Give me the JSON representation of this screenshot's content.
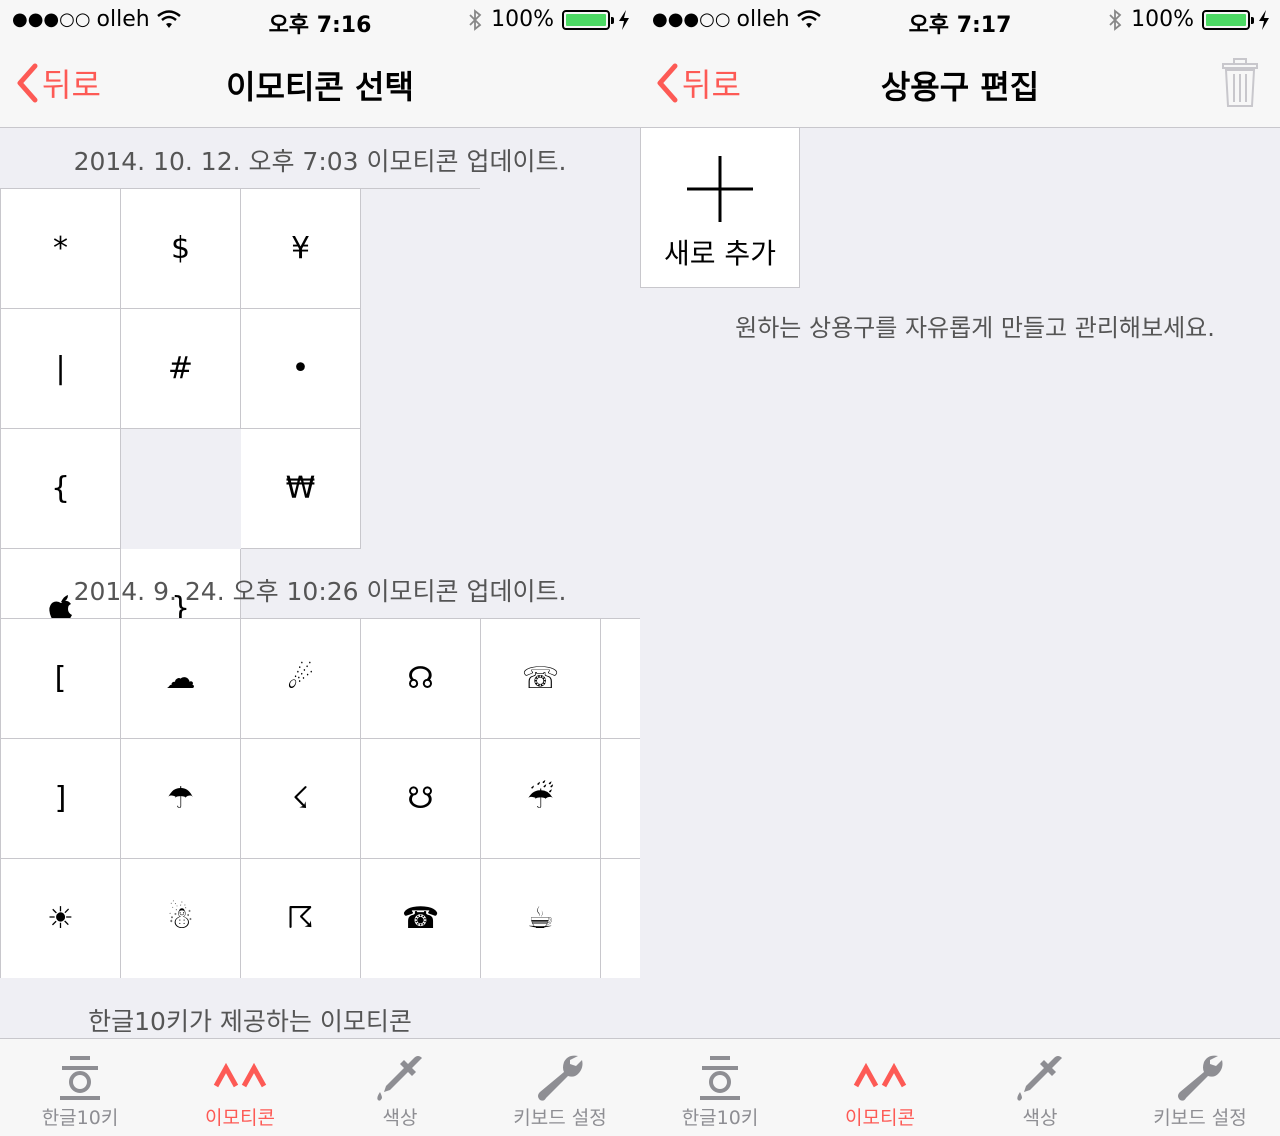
{
  "status_left": {
    "dots": "●●●○○",
    "carrier": "olleh",
    "battery": "100%"
  },
  "status_right": {
    "dots": "●●●○○",
    "carrier": "olleh",
    "battery": "100%"
  },
  "left": {
    "time": "오후 7:16",
    "back_label": "뒤로",
    "title": "이모티콘 선택",
    "section1_label": "2014. 10. 12. 오후 7:03 이모티콘 업데이트.",
    "section1_cells": [
      "*",
      "$",
      "¥",
      "|",
      "#",
      "•",
      "{",
      "",
      "₩",
      "",
      "}"
    ],
    "section2_label": "2014. 9. 24. 오후 10:26 이모티콘 업데이트.",
    "section2_cells": [
      "[",
      "☁",
      "☄",
      "☊",
      "☏",
      "",
      "]",
      "☂",
      "☇",
      "☋",
      "☔",
      "",
      "☀",
      "☃",
      "☈",
      "☎",
      "☕",
      ""
    ],
    "section3_label": "한글10키가 제공하는 이모티콘"
  },
  "right": {
    "time": "오후 7:17",
    "back_label": "뒤로",
    "title": "상용구 편집",
    "add_label": "새로 추가",
    "hint": "원하는 상용구를 자유롭게 만들고 관리해보세요."
  },
  "tabs": [
    {
      "label": "한글10키",
      "icon": "hangul-icon",
      "active": false
    },
    {
      "label": "이모티콘",
      "icon": "caret-icon",
      "active": true
    },
    {
      "label": "색상",
      "icon": "dropper-icon",
      "active": false
    },
    {
      "label": "키보드 설정",
      "icon": "wrench-icon",
      "active": false
    }
  ],
  "colors": {
    "accent": "#fd5a55",
    "battery": "#4cd964",
    "background": "#efeff4"
  }
}
